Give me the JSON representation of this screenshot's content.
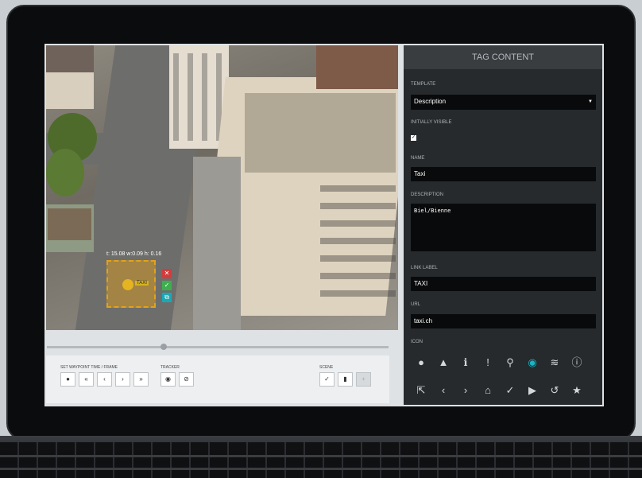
{
  "video": {
    "tag_info": "t: 15.08 w:0.09 h: 0.16",
    "tag_name": "TAXI",
    "tag_actions": [
      "✕",
      "✓",
      "⧉"
    ]
  },
  "controls": {
    "waypoint_label": "SET WAYPOINT TIME / FRAME",
    "tracker_label": "TRACKER",
    "scene_label": "SCENE",
    "waypoint_buttons": [
      "●",
      "«",
      "‹",
      "›",
      "»"
    ],
    "tracker_buttons": [
      "◉",
      "⊘"
    ],
    "scene_buttons": [
      "✓",
      "▮",
      "+"
    ]
  },
  "panel": {
    "title": "TAG CONTENT",
    "template_label": "TEMPLATE",
    "template_value": "Description",
    "initially_visible_label": "INITIALLY VISIBLE",
    "initially_visible_checked": true,
    "name_label": "NAME",
    "name_value": "Taxi",
    "description_label": "DESCRIPTION",
    "description_value": "Biel/Bienne",
    "link_label_label": "LINK LABEL",
    "link_label_value": "TAXI",
    "url_label": "URL",
    "url_value": "taxi.ch",
    "icon_label": "ICON",
    "selected_icon": "eye-icon",
    "accent_color": "#19b4c6",
    "icons_row1": [
      {
        "name": "circle-icon",
        "glyph": "●"
      },
      {
        "name": "warning-icon",
        "glyph": "▲"
      },
      {
        "name": "info-circle-icon",
        "glyph": "ℹ"
      },
      {
        "name": "exclamation-icon",
        "glyph": "!"
      },
      {
        "name": "map-pin-icon",
        "glyph": "⚲"
      },
      {
        "name": "eye-icon",
        "glyph": "◉"
      },
      {
        "name": "wifi-icon",
        "glyph": "≋"
      },
      {
        "name": "info-outline-icon",
        "glyph": "ⓘ"
      }
    ],
    "icons_row2": [
      {
        "name": "external-link-icon",
        "glyph": "⇱"
      },
      {
        "name": "chevron-left-icon",
        "glyph": "‹"
      },
      {
        "name": "chevron-right-icon",
        "glyph": "›"
      },
      {
        "name": "home-icon",
        "glyph": "⌂"
      },
      {
        "name": "check-icon",
        "glyph": "✓"
      },
      {
        "name": "play-icon",
        "glyph": "▶"
      },
      {
        "name": "undo-icon",
        "glyph": "↺"
      },
      {
        "name": "star-icon",
        "glyph": "★"
      }
    ]
  }
}
